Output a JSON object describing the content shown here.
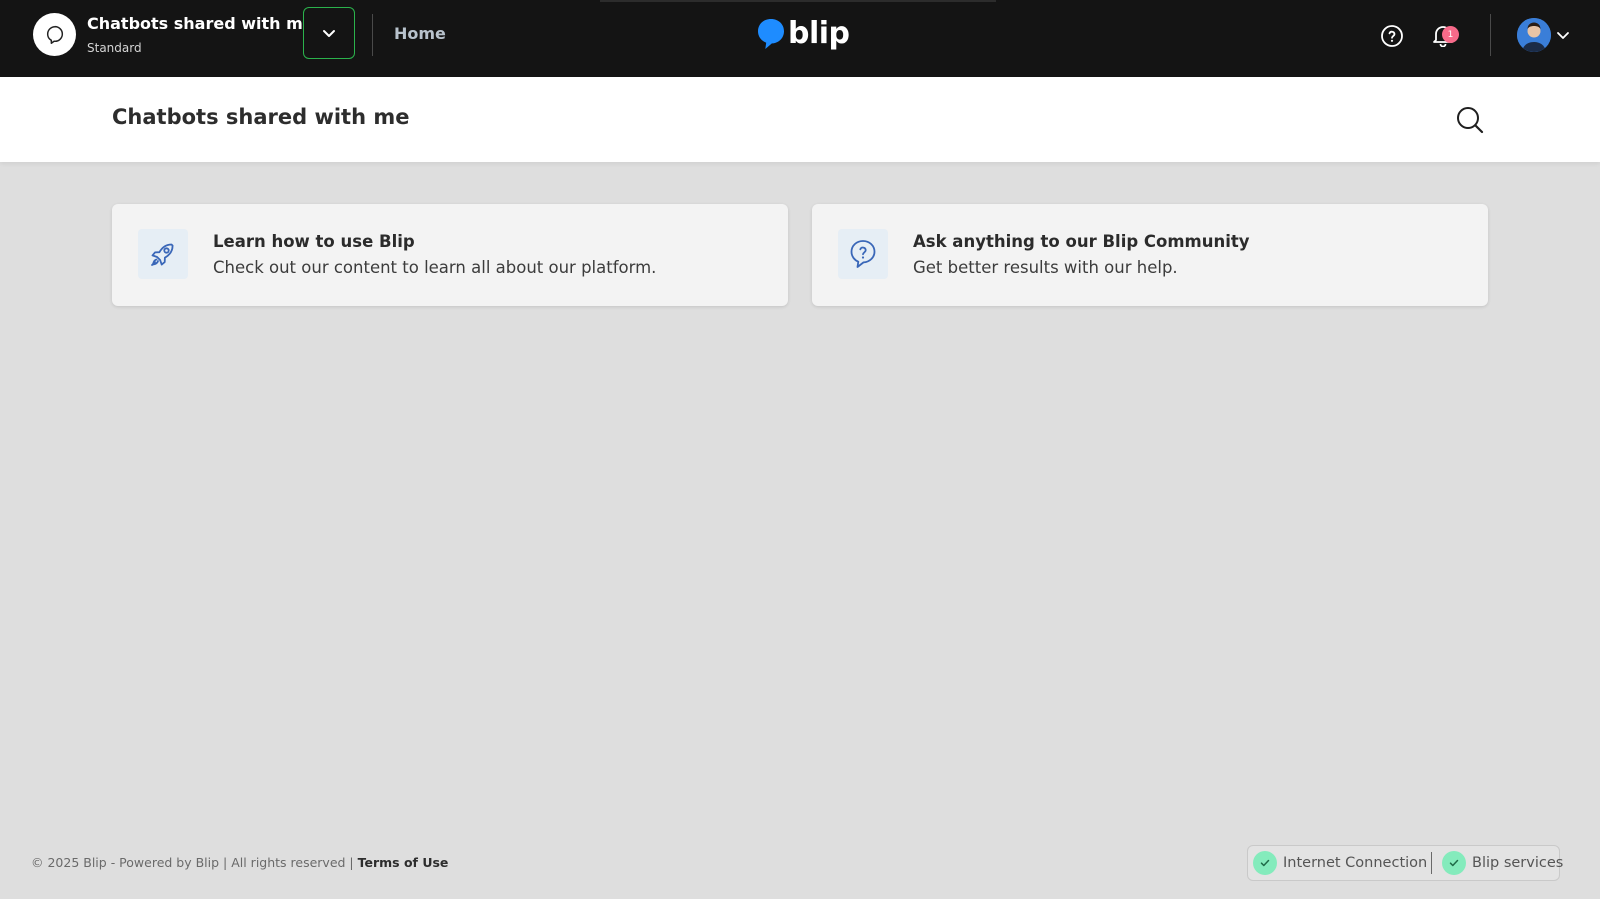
{
  "topbar": {
    "workspace_title": "Chatbots shared with me",
    "workspace_plan": "Standard",
    "home_label": "Home",
    "logo_text": "blip",
    "notification_count": "1",
    "colors": {
      "background": "#141414",
      "accent_border": "#2bb24c",
      "logo_blue": "#1e8cff",
      "badge": "#f76a8a"
    }
  },
  "page": {
    "title": "Chatbots shared with me"
  },
  "cards": [
    {
      "title": "Learn how to use Blip",
      "description": "Check out our content to learn all about our platform.",
      "icon": "rocket-icon"
    },
    {
      "title": "Ask anything to our Blip Community",
      "description": "Get better results with our help.",
      "icon": "question-bubble-icon"
    }
  ],
  "footer": {
    "copyright": "© 2025 Blip - Powered by Blip | All rights reserved | ",
    "terms_label": "Terms of Use"
  },
  "status": {
    "internet_label": "Internet Connection",
    "services_label": "Blip services",
    "ok_color": "#84ebbc"
  }
}
